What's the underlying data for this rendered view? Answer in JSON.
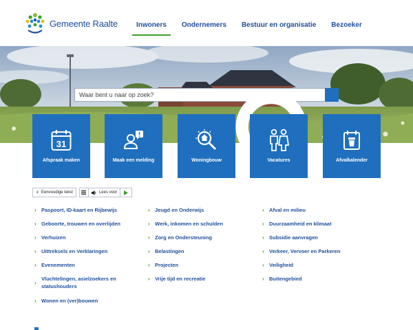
{
  "header": {
    "logo_text": "Gemeente Raalte",
    "nav": [
      {
        "label": "Inwoners",
        "active": true
      },
      {
        "label": "Ondernemers",
        "active": false
      },
      {
        "label": "Bestuur en organisatie",
        "active": false
      },
      {
        "label": "Bezoeker",
        "active": false
      }
    ]
  },
  "search": {
    "placeholder": "Waar bent u naar op zoek?",
    "value": ""
  },
  "tiles": [
    {
      "label": "Afspraak maken",
      "icon": "calendar-icon",
      "icon_text": "31"
    },
    {
      "label": "Maak een melding",
      "icon": "report-person-icon"
    },
    {
      "label": "Woningbouw",
      "icon": "house-magnifier-icon"
    },
    {
      "label": "Vacatures",
      "icon": "people-icon"
    },
    {
      "label": "Afvalkalender",
      "icon": "waste-calendar-icon"
    }
  ],
  "readspeaker": {
    "easy_text": "Eenvoudige tekst",
    "listen": "Lees voor"
  },
  "links": {
    "col1": [
      "Paspoort, ID-kaart en Rijbewijs",
      "Geboorte, trouwen en overlijden",
      "Verhuizen",
      "Uittreksels en Verklaringen",
      "Evenementen",
      "Vluchtelingen, asielzoekers en statushouders",
      "Wonen en (ver)bouwen"
    ],
    "col2": [
      "Jeugd en Onderwijs",
      "Werk, inkomen en schulden",
      "Zorg en Ondersteuning",
      "Belastingen",
      "Projecten",
      "Vrije tijd en recreatie"
    ],
    "col3": [
      "Afval en milieu",
      "Duurzaamheid en klimaat",
      "Subsidie aanvragen",
      "Verkeer, Vervoer en Parkeren",
      "Veiligheid",
      "Buitengebied"
    ]
  },
  "colors": {
    "brand_blue": "#1f6fbe",
    "text_blue": "#1f4f9e",
    "accent_green": "#3aa02a"
  }
}
